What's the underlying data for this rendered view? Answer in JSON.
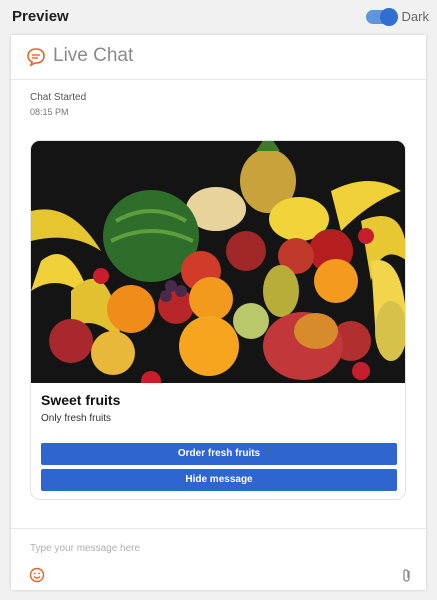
{
  "header": {
    "title": "Preview",
    "toggle_label": "Dark",
    "toggle_on": true
  },
  "chat": {
    "title": "Live Chat",
    "status": "Chat Started",
    "time": "08:15 PM",
    "message": {
      "title": "Sweet fruits",
      "subtitle": "Only fresh fruits",
      "buttons": [
        "Order fresh fruits",
        "Hide message"
      ]
    },
    "input_placeholder": "Type your message here"
  },
  "colors": {
    "accent": "#2f65cf",
    "icon_orange": "#e8622c",
    "toggle": "#2f6fd1"
  },
  "icons": {
    "chat": "chat-bubble-icon",
    "emoji": "smiley-icon",
    "attach": "paperclip-icon"
  }
}
